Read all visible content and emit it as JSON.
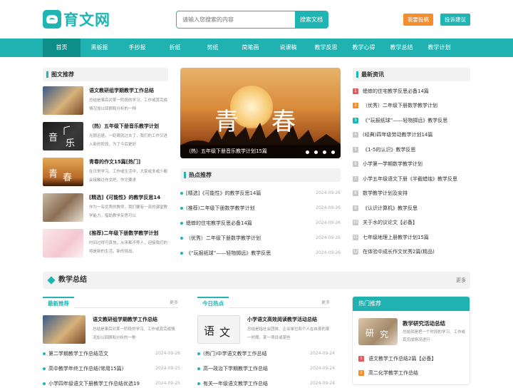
{
  "header": {
    "logo_text": "育文网",
    "search_placeholder": "请输入您搜索的内容",
    "search_button": "搜索文档",
    "submit_button": "我要投稿",
    "suggest_button": "投诉建议"
  },
  "nav": [
    "首页",
    "黑板报",
    "手抄报",
    "折纸",
    "剪纸",
    "简笔画",
    "说课稿",
    "教学反思",
    "教学心得",
    "教学总结",
    "教学计划"
  ],
  "image_recs": {
    "title": "图文推荐",
    "items": [
      {
        "title": "语文教研组学期教学工作总结",
        "desc": "总结是事后对某一阶段的学习、工作或其完成情况加以回顾和分析的一种"
      },
      {
        "title": "（热）五年级下册音乐教学计划",
        "desc": "光阴迅速，一眨眼就过去了，我们的工作又进入新的阶段，为了今后更好"
      },
      {
        "title": "青春的作文15篇[热门]",
        "desc": "在日常学习、工作或生活中，大家或多或少都会接触过作文吧，作文要求"
      },
      {
        "title": "[精选]《可能性》的教学反思14",
        "desc": "作为一名优秀的教师，我们要有一流的课堂教学能力，借助教学反思可以"
      },
      {
        "title": "(推荐)二年级下册数学教学计划",
        "desc": "时间过得可真快，从来都不等人，迎接我们的将是新的生活，新的挑战，"
      }
    ]
  },
  "banner": {
    "char1": "青",
    "char2": "春",
    "caption": "（热）五年级下册音乐教学计划15篇"
  },
  "hot_recs": {
    "title": "热点推荐",
    "items": [
      {
        "title": "[精选]《可能性》的教学反思14篇",
        "date": "2024-09-26"
      },
      {
        "title": "(推荐)二年级下册数学教学计划",
        "date": "2024-09-26"
      },
      {
        "title": "蟋蟀的住宅教学反思必备14篇",
        "date": "2024-09-26"
      },
      {
        "title": "（优秀）二年级下册数学教学计划",
        "date": "2024-09-26"
      },
      {
        "title": "《“玩报纸球”——轻物掷远》教学反思",
        "date": "2024-09-26"
      }
    ]
  },
  "latest": {
    "title": "最新资讯",
    "items": [
      "蟋蟀的住宅教学反思必备14篇",
      "（优秀）二年级下册数学教学计划",
      "《“玩报纸球”——轻物掷远》教学反思",
      "(经典)四年级劳动教学计划14篇",
      "《1-5的认识》教学反思",
      "小学第一学期数学教学计划",
      "小学五年级语文下册《半截蜡烛》教学反思",
      "数学教学计划及安排",
      "《认识计算机》教学反思",
      "关于水的议论文【必备】",
      "七年级地理上册教学计划15篇",
      "在体验中成长作文优秀2篇(精品)"
    ]
  },
  "section": {
    "title": "教学总结",
    "more": "更多"
  },
  "col1": {
    "tab": "最新推荐",
    "more": "更多",
    "feature": {
      "title": "语文教研组学期教学工作总结",
      "desc": "总结是事后对某一阶段的学习、工作或其完成情况加以回顾和分析的一种"
    },
    "items": [
      {
        "title": "第二学期教学工作总结范文",
        "date": "2024-09-26"
      },
      {
        "title": "高中教学年终工作总结(常用15篇)",
        "date": "2024-09-25"
      },
      {
        "title": "小学四年级语文下册教学工作总结优选19",
        "date": "2024-09-25"
      }
    ]
  },
  "col2": {
    "tab": "今日热点",
    "more": "更多",
    "feature": {
      "title": "小学语文高效阅读教学活动总结",
      "desc": "总结是指社会团体、企业单位和个人在自身的某一时期、某一项目或某些"
    },
    "items": [
      {
        "title": "(热门)中学语文教学工作总结",
        "date": "2024-09-24"
      },
      {
        "title": "高一政治下学期教学工作总结",
        "date": "2024-09-24"
      },
      {
        "title": "有关一年级语文教学工作总结",
        "date": "2024-09-24"
      }
    ]
  },
  "col3": {
    "title": "热门推荐",
    "feature": {
      "title": "教学研究活动总结",
      "desc": "总结就是把一个时段的学习、工作或其完成情况进行"
    },
    "items": [
      "语文教学工作总结2篇【必备】",
      "高二化学教学工作总结"
    ]
  }
}
